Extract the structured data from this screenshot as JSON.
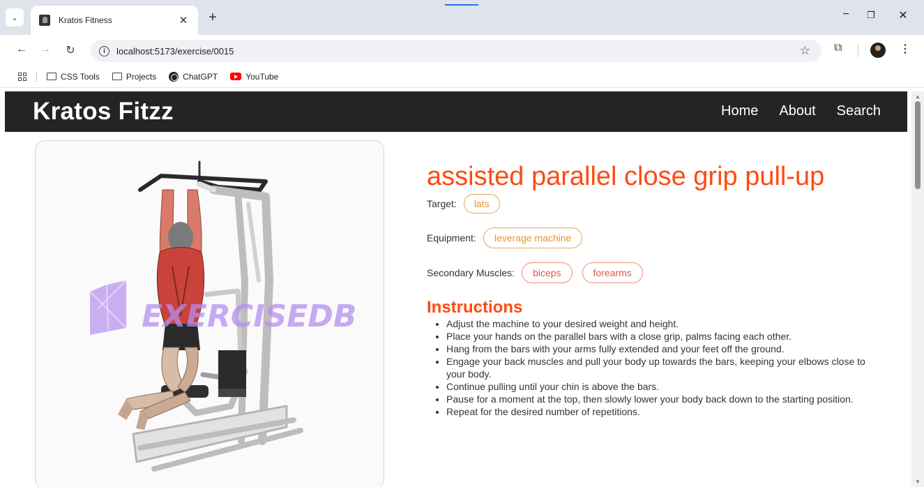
{
  "browser": {
    "tab_title": "Kratos Fitness",
    "url": "localhost:5173/exercise/0015",
    "bookmarks": [
      "CSS Tools",
      "Projects",
      "ChatGPT",
      "YouTube"
    ],
    "accent_color": "#1a73e8"
  },
  "site": {
    "brand": "Kratos Fitzz",
    "nav": [
      "Home",
      "About",
      "Search"
    ],
    "navbar_color": "#242424"
  },
  "exercise": {
    "name": "assisted parallel close grip pull-up",
    "image_watermark": "EXERCISEDB",
    "target_label": "Target:",
    "target": "lats",
    "equipment_label": "Equipment:",
    "equipment": "leverage machine",
    "secondary_label": "Secondary Muscles:",
    "secondary_muscles": [
      "biceps",
      "forearms"
    ],
    "instructions_heading": "Instructions",
    "instructions": [
      "Adjust the machine to your desired weight and height.",
      "Place your hands on the parallel bars with a close grip, palms facing each other.",
      "Hang from the bars with your arms fully extended and your feet off the ground.",
      "Engage your back muscles and pull your body up towards the bars, keeping your elbows close to your body.",
      "Continue pulling until your chin is above the bars.",
      "Pause for a moment at the top, then slowly lower your body back down to the starting position.",
      "Repeat for the desired number of repetitions."
    ],
    "accent_color": "#ff4a11"
  }
}
